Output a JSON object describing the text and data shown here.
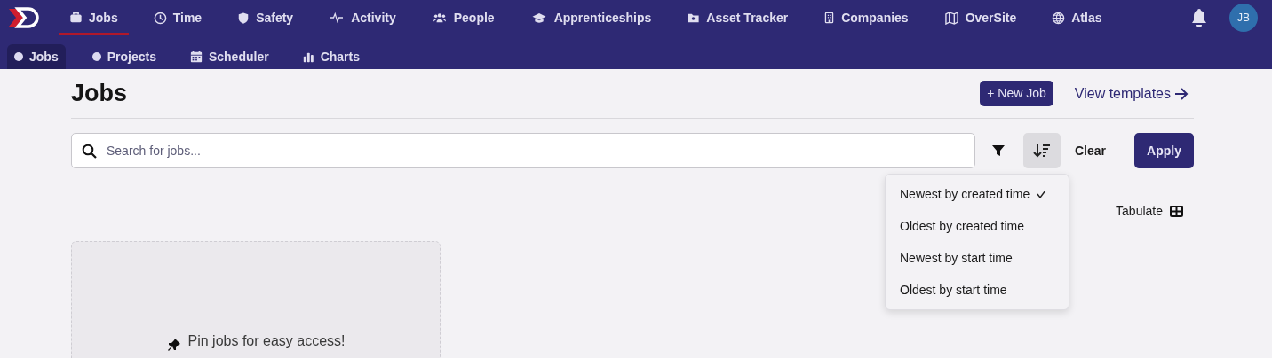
{
  "nav": {
    "avatar": "JB",
    "items": [
      {
        "label": "Jobs",
        "selected": true
      },
      {
        "label": "Time",
        "selected": false
      },
      {
        "label": "Safety",
        "selected": false
      },
      {
        "label": "Activity",
        "selected": false
      },
      {
        "label": "People",
        "selected": false
      },
      {
        "label": "Apprenticeships",
        "selected": false
      },
      {
        "label": "Asset Tracker",
        "selected": false
      },
      {
        "label": "Companies",
        "selected": false
      },
      {
        "label": "OverSite",
        "selected": false
      },
      {
        "label": "Atlas",
        "selected": false
      }
    ]
  },
  "subnav": [
    {
      "label": "Jobs",
      "selected": true
    },
    {
      "label": "Projects",
      "selected": false
    },
    {
      "label": "Scheduler",
      "selected": false
    },
    {
      "label": "Charts",
      "selected": false
    }
  ],
  "page": {
    "title": "Jobs",
    "new_button": "+ New Job",
    "templates_link": "View templates"
  },
  "search": {
    "placeholder": "Search for jobs..."
  },
  "toolbar": {
    "clear": "Clear",
    "apply": "Apply",
    "tabulate": "Tabulate"
  },
  "sort_menu": [
    {
      "label": "Newest by created time",
      "selected": true
    },
    {
      "label": "Oldest by created time",
      "selected": false
    },
    {
      "label": "Newest by start time",
      "selected": false
    },
    {
      "label": "Oldest by start time",
      "selected": false
    }
  ],
  "pinned": {
    "empty_text": "Pin jobs for easy access!"
  }
}
